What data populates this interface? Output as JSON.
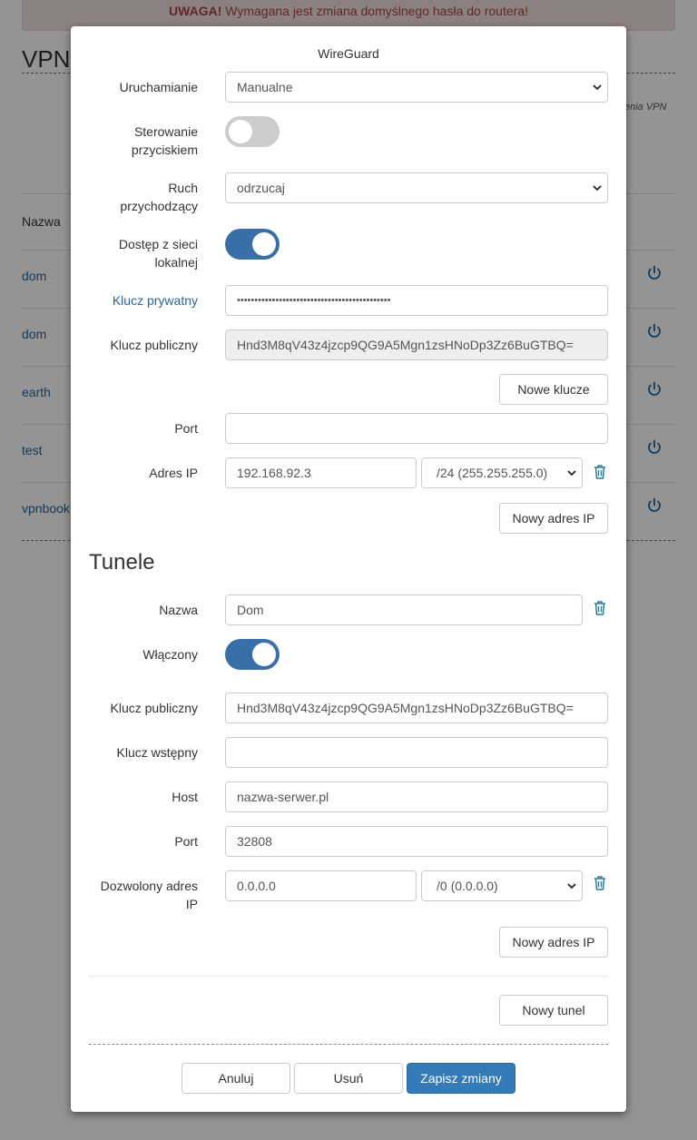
{
  "background": {
    "alert_bold": "UWAGA!",
    "alert_text": " Wymagana jest zmiana domyślnego hasła do routera!",
    "page_title": "VPN",
    "note": "enia VPN",
    "column_header": "Nazwa",
    "rows": [
      {
        "name": "dom"
      },
      {
        "name": "dom"
      },
      {
        "name": "earth"
      },
      {
        "name": "test"
      },
      {
        "name": "vpnbook"
      }
    ]
  },
  "modal": {
    "title": "WireGuard",
    "startup_label": "Uruchamianie",
    "startup_value": "Manualne",
    "button_control_label": "Sterowanie przyciskiem",
    "button_control_state": "off",
    "incoming_label": "Ruch przychodzący",
    "incoming_value": "odrzucaj",
    "lan_access_label": "Dostęp z sieci lokalnej",
    "lan_access_state": "on",
    "private_key_label": "Klucz prywatny",
    "private_key_value": "••••••••••••••••••••••••••••••••••••••••••••",
    "public_key_label": "Klucz publiczny",
    "public_key_value": "Hnd3M8qV43z4jzcp9QG9A5Mgn1zsHNoDp3Zz6BuGTBQ=",
    "new_keys_button": "Nowe klucze",
    "port_label": "Port",
    "port_value": "",
    "ip_label": "Adres IP",
    "ip_value": "192.168.92.3",
    "ip_mask": "/24 (255.255.255.0)",
    "new_ip_button": "Nowy adres IP",
    "tunnels_title": "Tunele",
    "tunnel": {
      "name_label": "Nazwa",
      "name_value": "Dom",
      "enabled_label": "Włączony",
      "enabled_state": "on",
      "public_key_label": "Klucz publiczny",
      "public_key_value": "Hnd3M8qV43z4jzcp9QG9A5Mgn1zsHNoDp3Zz6BuGTBQ=",
      "preshared_label": "Klucz wstępny",
      "preshared_value": "",
      "host_label": "Host",
      "host_value": "nazwa-serwer.pl",
      "port_label": "Port",
      "port_value": "32808",
      "allowed_ip_label": "Dozwolony adres IP",
      "allowed_ip_value": "0.0.0.0",
      "allowed_ip_mask": "/0 (0.0.0.0)",
      "new_ip_button": "Nowy adres IP"
    },
    "new_tunnel_button": "Nowy tunel",
    "cancel_button": "Anuluj",
    "delete_button": "Usuń",
    "save_button": "Zapisz zmiany"
  },
  "colors": {
    "primary": "#337ab7",
    "toggle_on": "#3a6ea8",
    "link": "#2a6496",
    "trash": "#2a7a96"
  }
}
